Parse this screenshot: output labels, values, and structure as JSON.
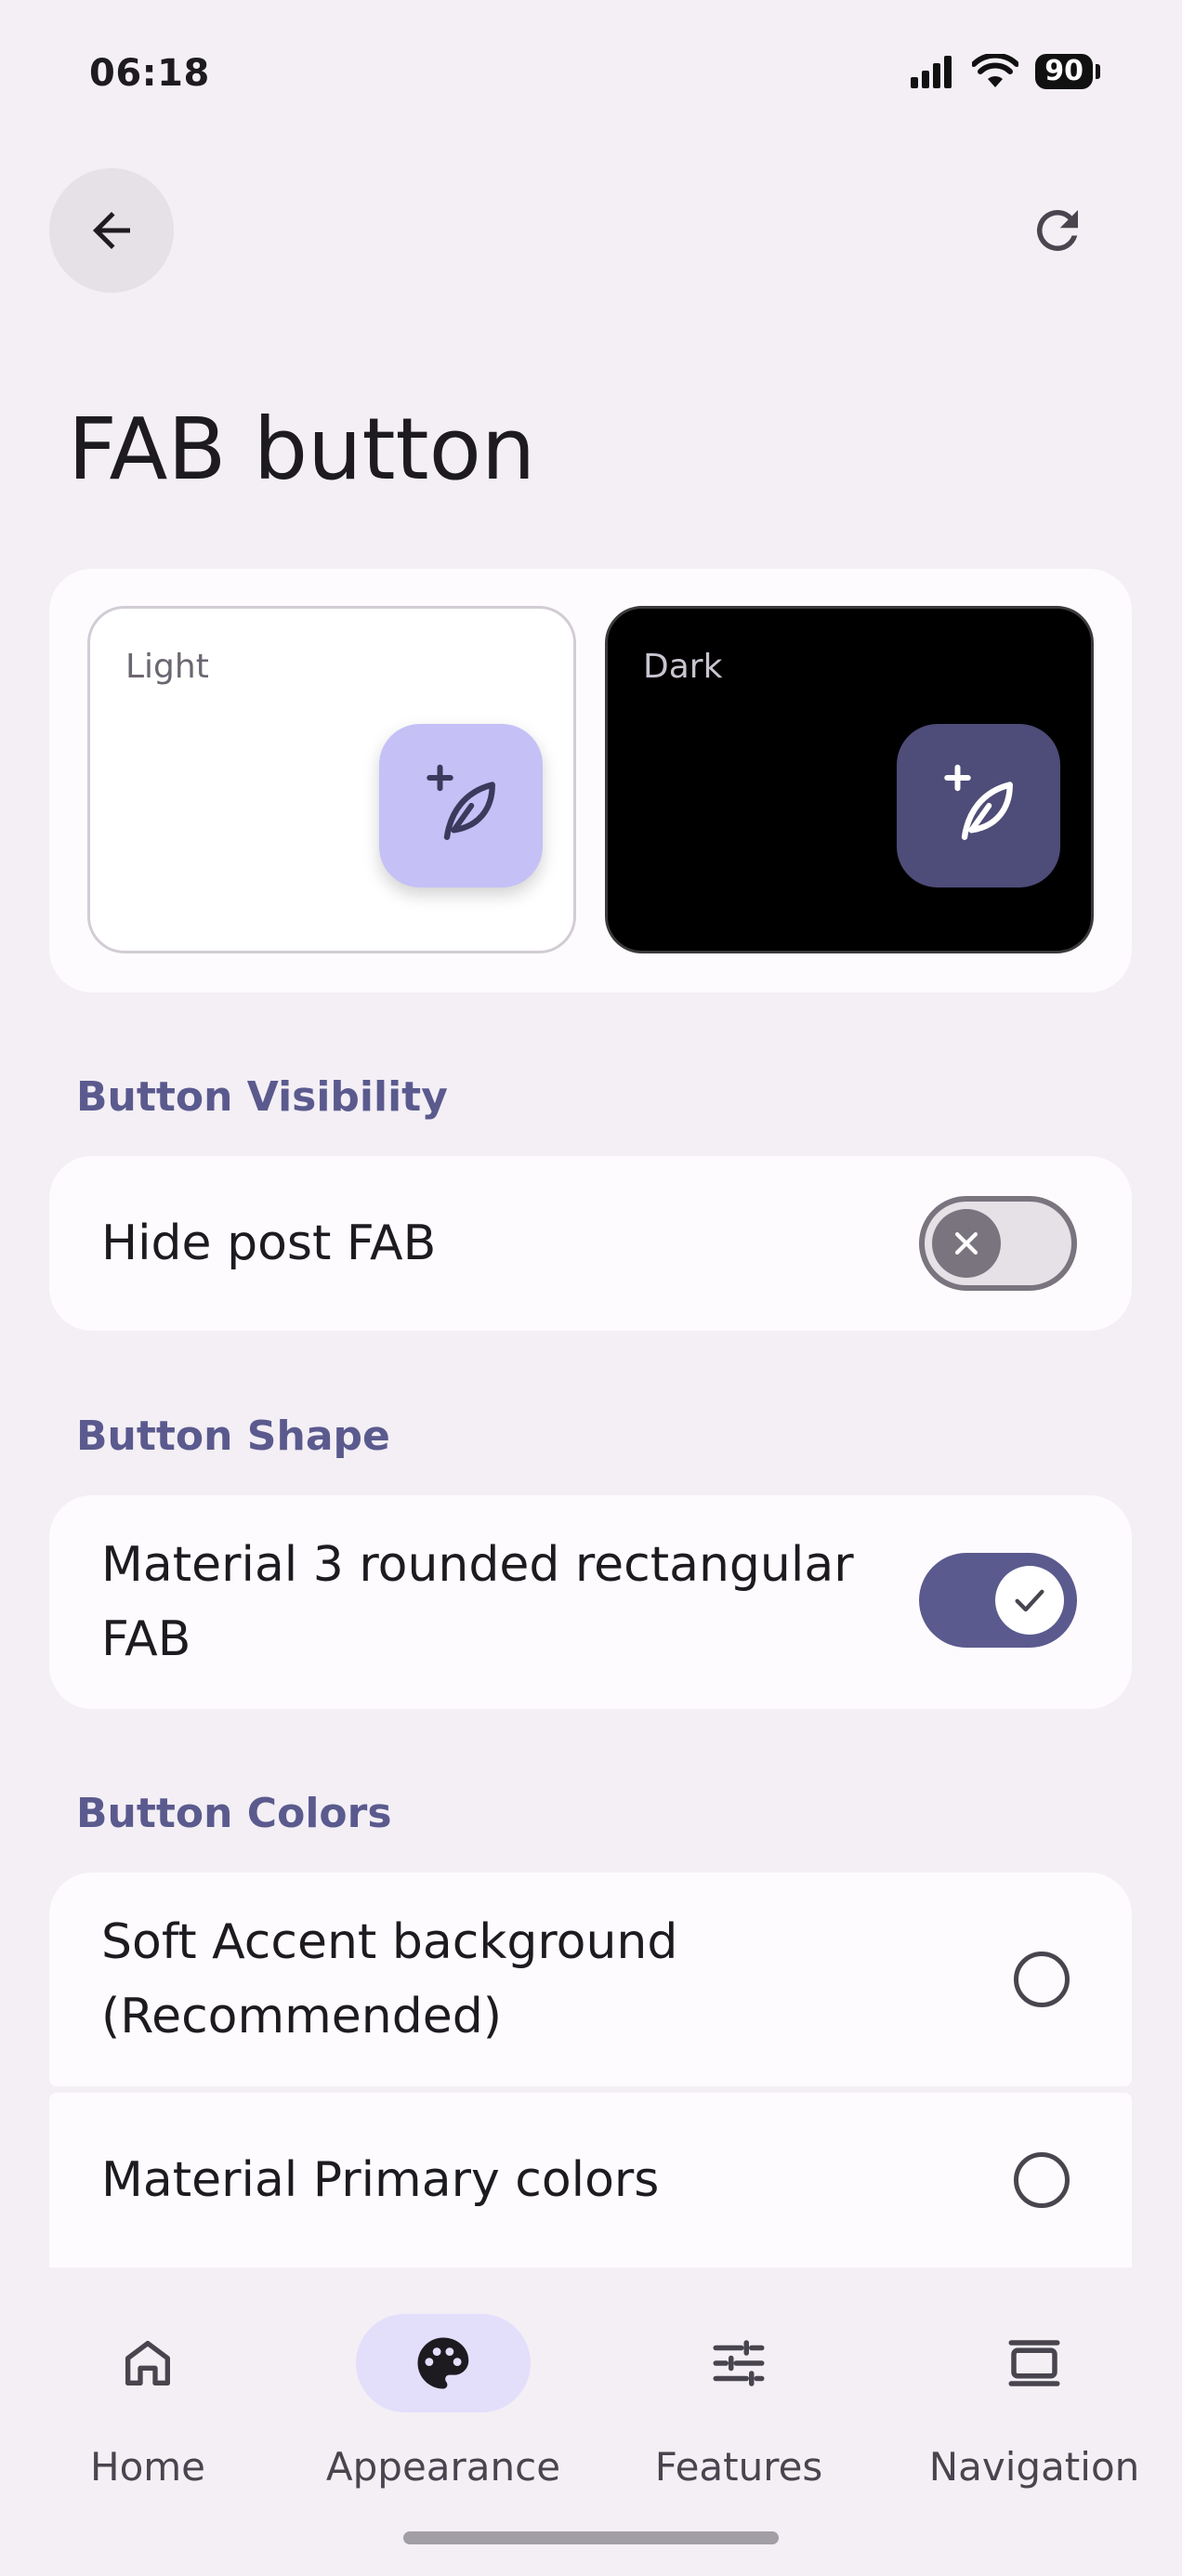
{
  "status_bar": {
    "time": "06:18",
    "battery": "90"
  },
  "page": {
    "title": "FAB button"
  },
  "preview": {
    "light_label": "Light",
    "dark_label": "Dark"
  },
  "sections": {
    "visibility": {
      "header": "Button Visibility",
      "hide_post_fab": "Hide post FAB",
      "hide_post_fab_on": false
    },
    "shape": {
      "header": "Button Shape",
      "material3_line1": "Material 3 rounded rectangular",
      "material3_line2": "FAB",
      "material3_on": true
    },
    "colors": {
      "header": "Button Colors",
      "soft_accent_line1": "Soft Accent background",
      "soft_accent_line2": "(Recommended)",
      "material_primary": "Material Primary colors"
    }
  },
  "bottom_nav": {
    "home": "Home",
    "appearance": "Appearance",
    "features": "Features",
    "navigation": "Navigation",
    "active": "appearance"
  },
  "colors": {
    "accent": "#5b5a8e",
    "fab_light": "#c5c0f6",
    "fab_dark": "#4e4c78",
    "background": "#f3eff5"
  }
}
